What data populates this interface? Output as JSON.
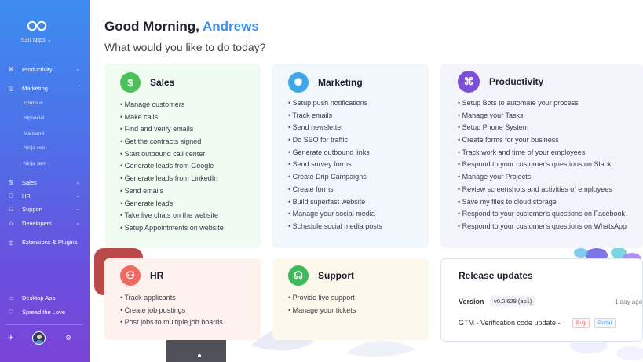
{
  "sidebar": {
    "apps_count": "530 apps",
    "nav": [
      {
        "label": "Productivity",
        "icon": "command-icon"
      },
      {
        "label": "Marketing",
        "icon": "target-icon"
      },
      {
        "label": "Sales",
        "icon": "dollar-icon"
      },
      {
        "label": "HR",
        "icon": "person-icon"
      },
      {
        "label": "Support",
        "icon": "headset-icon"
      },
      {
        "label": "Developers",
        "icon": "code-icon"
      },
      {
        "label": "Extensions & Plugins",
        "icon": "plug-icon"
      }
    ],
    "marketing_sub": [
      "Forms.ic",
      "Hipsocial",
      "Mailsend",
      "Ninja seo",
      "Ninja sem"
    ],
    "bottom": [
      {
        "label": "Desktop App",
        "icon": "monitor-icon"
      },
      {
        "label": "Spread the Love",
        "icon": "heart-icon"
      }
    ]
  },
  "main": {
    "greeting_prefix": "Good Morning,",
    "user_name": "Andrews",
    "question": "What would you like to do today?"
  },
  "cards": {
    "sales": {
      "title": "Sales",
      "icon": "dollar-icon",
      "color": "#4cc15a",
      "items": [
        "Manage customers",
        "Make calls",
        "Find and verify emails",
        "Get the contracts signed",
        "Start outbound call center",
        "Generate leads from Google",
        "Generate leads from LinkedIn",
        "Send emails",
        "Generate leads",
        "Take live chats on the website",
        "Setup Appointments on website"
      ]
    },
    "marketing": {
      "title": "Marketing",
      "icon": "target-icon",
      "color": "#3fa6e8",
      "items": [
        "Setup push notifications",
        "Track emails",
        "Send newsletter",
        "Do SEO for traffic",
        "Generate outbound links",
        "Send survey forms",
        "Create Drip Campaigns",
        "Create forms",
        "Build superfast website",
        "Manage your social media",
        "Schedule social media posts"
      ]
    },
    "productivity": {
      "title": "Productivity",
      "icon": "command-icon",
      "color": "#7b4fd6",
      "items": [
        "Setup Bots to automate your process",
        "Manage your Tasks",
        "Setup Phone System",
        "Create forms for your business",
        "Track work and time of your employees",
        "Respond to your customer's questions on Slack",
        "Manage your Projects",
        "Review screenshots and activities of employees",
        "Save my files to cloud storage",
        "Respond to your customer's questions on Facebook",
        "Respond to your customer's questions on WhatsApp"
      ]
    },
    "hr": {
      "title": "HR",
      "icon": "person-icon",
      "color": "#f06a62",
      "items": [
        "Track applicants",
        "Create job postings",
        "Post jobs to multiple job boards"
      ]
    },
    "support": {
      "title": "Support",
      "icon": "headset-icon",
      "color": "#3dba5b",
      "items": [
        "Provide live support",
        "Manage your tickets"
      ]
    }
  },
  "release": {
    "title": "Release updates",
    "version_label": "Version",
    "version_value": "v0.0.629 (ap1)",
    "time": "1 day ago",
    "entry": "GTM - Verification code update -",
    "tags": [
      "Bug",
      "Portal"
    ]
  }
}
